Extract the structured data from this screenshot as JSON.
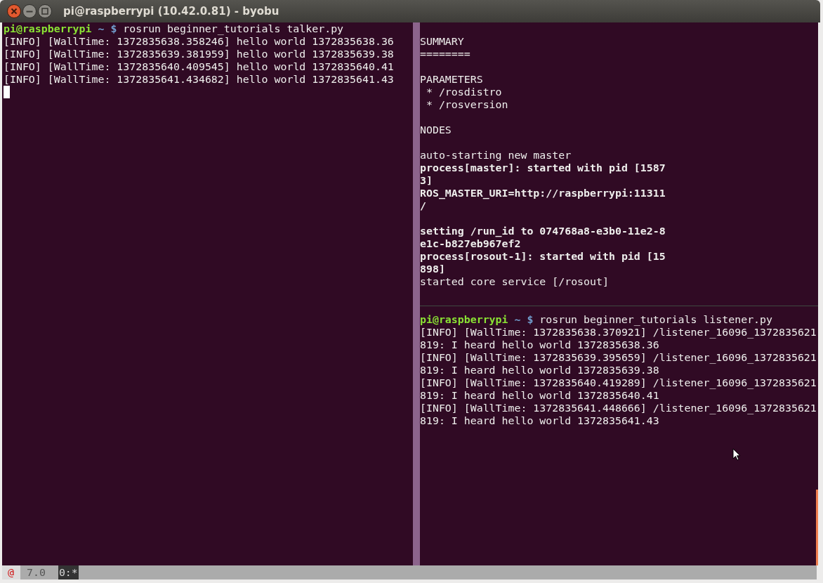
{
  "window": {
    "title": "pi@raspberrypi (10.42.0.81) - byobu"
  },
  "panes": [
    {
      "kind": "left",
      "cursor": true,
      "lines": [
        {
          "kind": "prompt",
          "user": "pi@raspberrypi",
          "path": "~ $",
          "command": "rosrun beginner_tutorials talker.py"
        },
        {
          "kind": "text",
          "bold": false,
          "text": "[INFO] [WallTime: 1372835638.358246] hello world 1372835638.36"
        },
        {
          "kind": "text",
          "bold": false,
          "text": "[INFO] [WallTime: 1372835639.381959] hello world 1372835639.38"
        },
        {
          "kind": "text",
          "bold": false,
          "text": "[INFO] [WallTime: 1372835640.409545] hello world 1372835640.41"
        },
        {
          "kind": "text",
          "bold": false,
          "text": "[INFO] [WallTime: 1372835641.434682] hello world 1372835641.43"
        }
      ]
    },
    {
      "kind": "top",
      "lines": [
        {
          "kind": "blank"
        },
        {
          "kind": "text",
          "bold": false,
          "text": "SUMMARY"
        },
        {
          "kind": "text",
          "bold": false,
          "text": "========"
        },
        {
          "kind": "blank"
        },
        {
          "kind": "text",
          "bold": false,
          "text": "PARAMETERS"
        },
        {
          "kind": "text",
          "bold": false,
          "text": " * /rosdistro"
        },
        {
          "kind": "text",
          "bold": false,
          "text": " * /rosversion"
        },
        {
          "kind": "blank"
        },
        {
          "kind": "text",
          "bold": false,
          "text": "NODES"
        },
        {
          "kind": "blank"
        },
        {
          "kind": "text",
          "bold": false,
          "text": "auto-starting new master"
        },
        {
          "kind": "text",
          "bold": true,
          "text": "process[master]: started with pid [1587"
        },
        {
          "kind": "text",
          "bold": true,
          "text": "3]"
        },
        {
          "kind": "text",
          "bold": true,
          "text": "ROS_MASTER_URI=http://raspberrypi:11311"
        },
        {
          "kind": "text",
          "bold": true,
          "text": "/"
        },
        {
          "kind": "blank"
        },
        {
          "kind": "text",
          "bold": true,
          "text": "setting /run_id to 074768a8-e3b0-11e2-8"
        },
        {
          "kind": "text",
          "bold": true,
          "text": "e1c-b827eb967ef2"
        },
        {
          "kind": "text",
          "bold": true,
          "text": "process[rosout-1]: started with pid [15"
        },
        {
          "kind": "text",
          "bold": true,
          "text": "898]"
        },
        {
          "kind": "text",
          "bold": false,
          "text": "started core service [/rosout]"
        }
      ]
    },
    {
      "kind": "bottom",
      "lines": [
        {
          "kind": "prompt",
          "user": "pi@raspberrypi",
          "path": "~ $",
          "command": "rosrun beginner_tutorials listener.py"
        },
        {
          "kind": "text",
          "bold": false,
          "text": "[INFO] [WallTime: 1372835638.370921] /listener_16096_1372835621"
        },
        {
          "kind": "text",
          "bold": false,
          "text": "819: I heard hello world 1372835638.36"
        },
        {
          "kind": "text",
          "bold": false,
          "text": "[INFO] [WallTime: 1372835639.395659] /listener_16096_1372835621"
        },
        {
          "kind": "text",
          "bold": false,
          "text": "819: I heard hello world 1372835639.38"
        },
        {
          "kind": "text",
          "bold": false,
          "text": "[INFO] [WallTime: 1372835640.419289] /listener_16096_1372835621"
        },
        {
          "kind": "text",
          "bold": false,
          "text": "819: I heard hello world 1372835640.41"
        },
        {
          "kind": "text",
          "bold": false,
          "text": "[INFO] [WallTime: 1372835641.448666] /listener_16096_1372835621"
        },
        {
          "kind": "text",
          "bold": false,
          "text": "819: I heard hello world 1372835641.43"
        }
      ]
    }
  ],
  "status_bar": {
    "logo": "@",
    "version": "7.0",
    "windows": [
      {
        "label": "0:*",
        "selected": true
      }
    ]
  }
}
